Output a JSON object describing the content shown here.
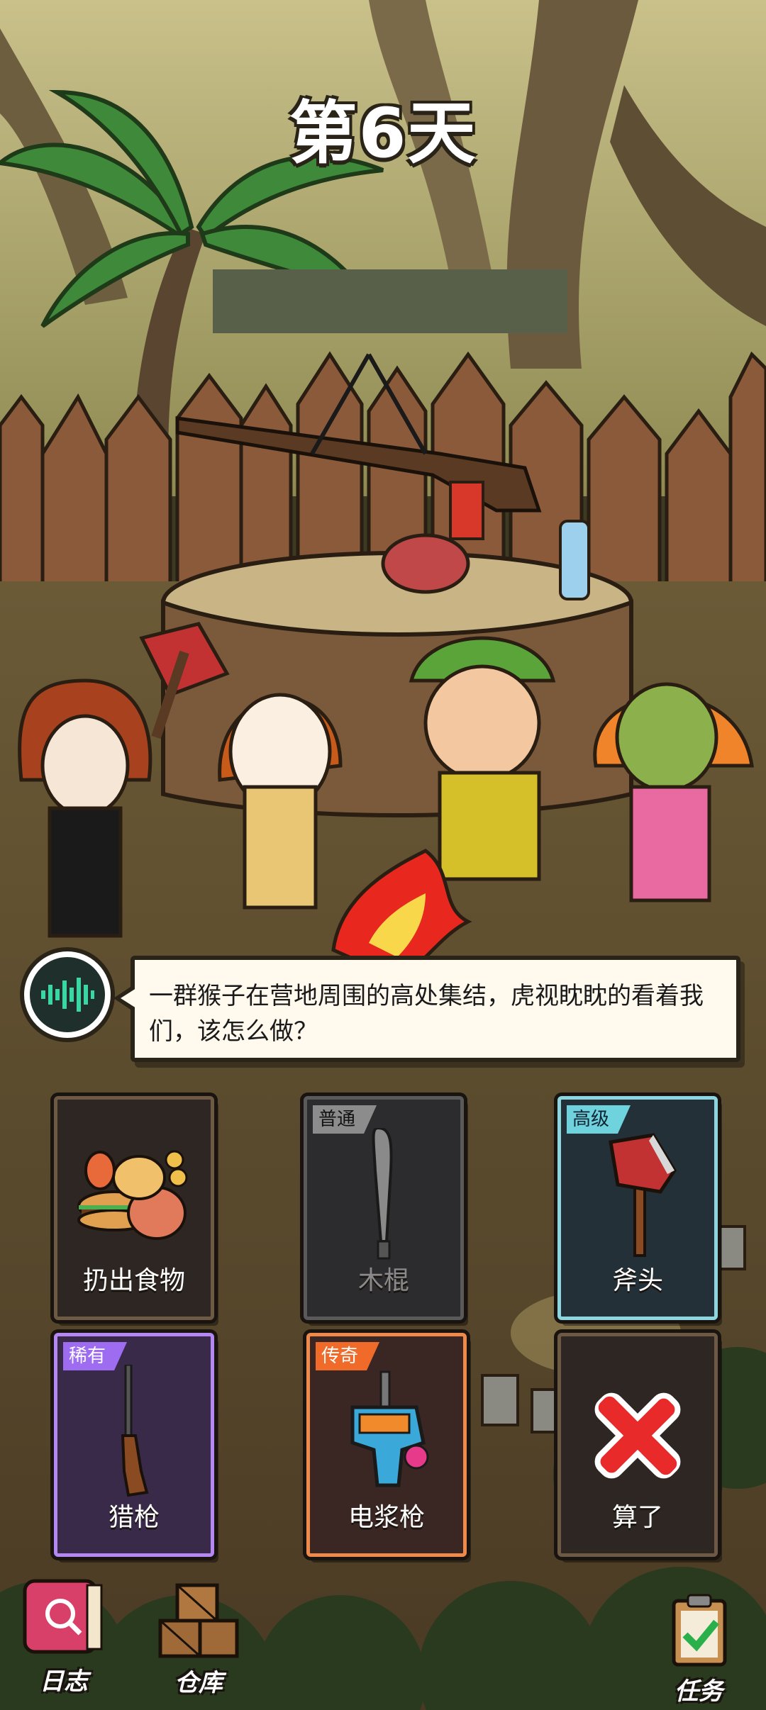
{
  "header": {
    "day_title": "第6天"
  },
  "dialog": {
    "text": "一群猴子在营地周围的高处集结，虎视眈眈的看着我们，该怎么做？"
  },
  "choices": [
    {
      "label": "扔出食物",
      "rarity_tag": "",
      "icon": "food-icon"
    },
    {
      "label": "木棍",
      "rarity_tag": "普通",
      "icon": "bat-icon"
    },
    {
      "label": "斧头",
      "rarity_tag": "高级",
      "icon": "axe-icon"
    },
    {
      "label": "猎枪",
      "rarity_tag": "稀有",
      "icon": "rifle-icon"
    },
    {
      "label": "电浆枪",
      "rarity_tag": "传奇",
      "icon": "plasma-gun-icon"
    },
    {
      "label": "算了",
      "rarity_tag": "",
      "icon": "cross-icon"
    }
  ],
  "bottom_nav": {
    "log": "日志",
    "warehouse": "仓库",
    "tasks": "任务"
  },
  "colors": {
    "common": "#8c8c8c",
    "advanced": "#6fd3dd",
    "rare": "#9d6cf0",
    "legend": "#f06a2a"
  }
}
